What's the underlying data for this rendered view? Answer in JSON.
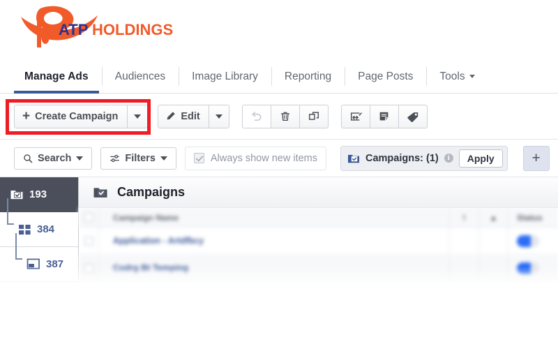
{
  "brand": {
    "name_primary": "ATP",
    "name_secondary": "HOLDINGS",
    "color_orange": "#f15a29",
    "color_navy": "#2e3192"
  },
  "tabs": [
    {
      "label": "Manage Ads",
      "active": true
    },
    {
      "label": "Audiences",
      "active": false
    },
    {
      "label": "Image Library",
      "active": false
    },
    {
      "label": "Reporting",
      "active": false
    },
    {
      "label": "Page Posts",
      "active": false
    },
    {
      "label": "Tools",
      "active": false,
      "has_caret": true
    }
  ],
  "toolbar": {
    "create_label": "Create Campaign",
    "create_plus": "+",
    "create_caret_name": "chevron-down-icon",
    "edit_label": "Edit",
    "edit_icon": "pencil-icon",
    "edit_caret_name": "chevron-down-icon",
    "icons": [
      {
        "name": "undo-icon",
        "disabled": true
      },
      {
        "name": "trash-icon",
        "disabled": false
      },
      {
        "name": "duplicate-icon",
        "disabled": false
      },
      {
        "name": "export-icon",
        "disabled": false
      },
      {
        "name": "notes-icon",
        "disabled": false
      },
      {
        "name": "tag-icon",
        "disabled": false
      }
    ],
    "highlight_color": "#ef1c24"
  },
  "filterbar": {
    "search_label": "Search",
    "search_icon": "search-icon",
    "filters_label": "Filters",
    "filters_icon": "sliders-icon",
    "always_show_label": "Always show new items",
    "always_show_checked": true,
    "campaigns_label": "Campaigns: (1)",
    "campaigns_icon": "campaign-folder-icon",
    "info_glyph": "i",
    "apply_label": "Apply",
    "add_label": "+"
  },
  "sidebar": {
    "items": [
      {
        "count": "193",
        "icon": "campaign-folder-icon",
        "level": 1,
        "selected": true
      },
      {
        "count": "384",
        "icon": "adset-grid-icon",
        "level": 2,
        "selected": false
      },
      {
        "count": "387",
        "icon": "ad-screen-icon",
        "level": 3,
        "selected": false
      }
    ]
  },
  "content": {
    "title": "Campaigns",
    "title_icon": "campaign-folder-icon",
    "table": {
      "headers": [
        "",
        "Campaign Name",
        "",
        "",
        "Status"
      ],
      "rows": [
        {
          "name": "Application - Artdfbcy",
          "status_on": true
        },
        {
          "name": "Codrg Bt Temping",
          "status_on": true
        }
      ]
    }
  }
}
